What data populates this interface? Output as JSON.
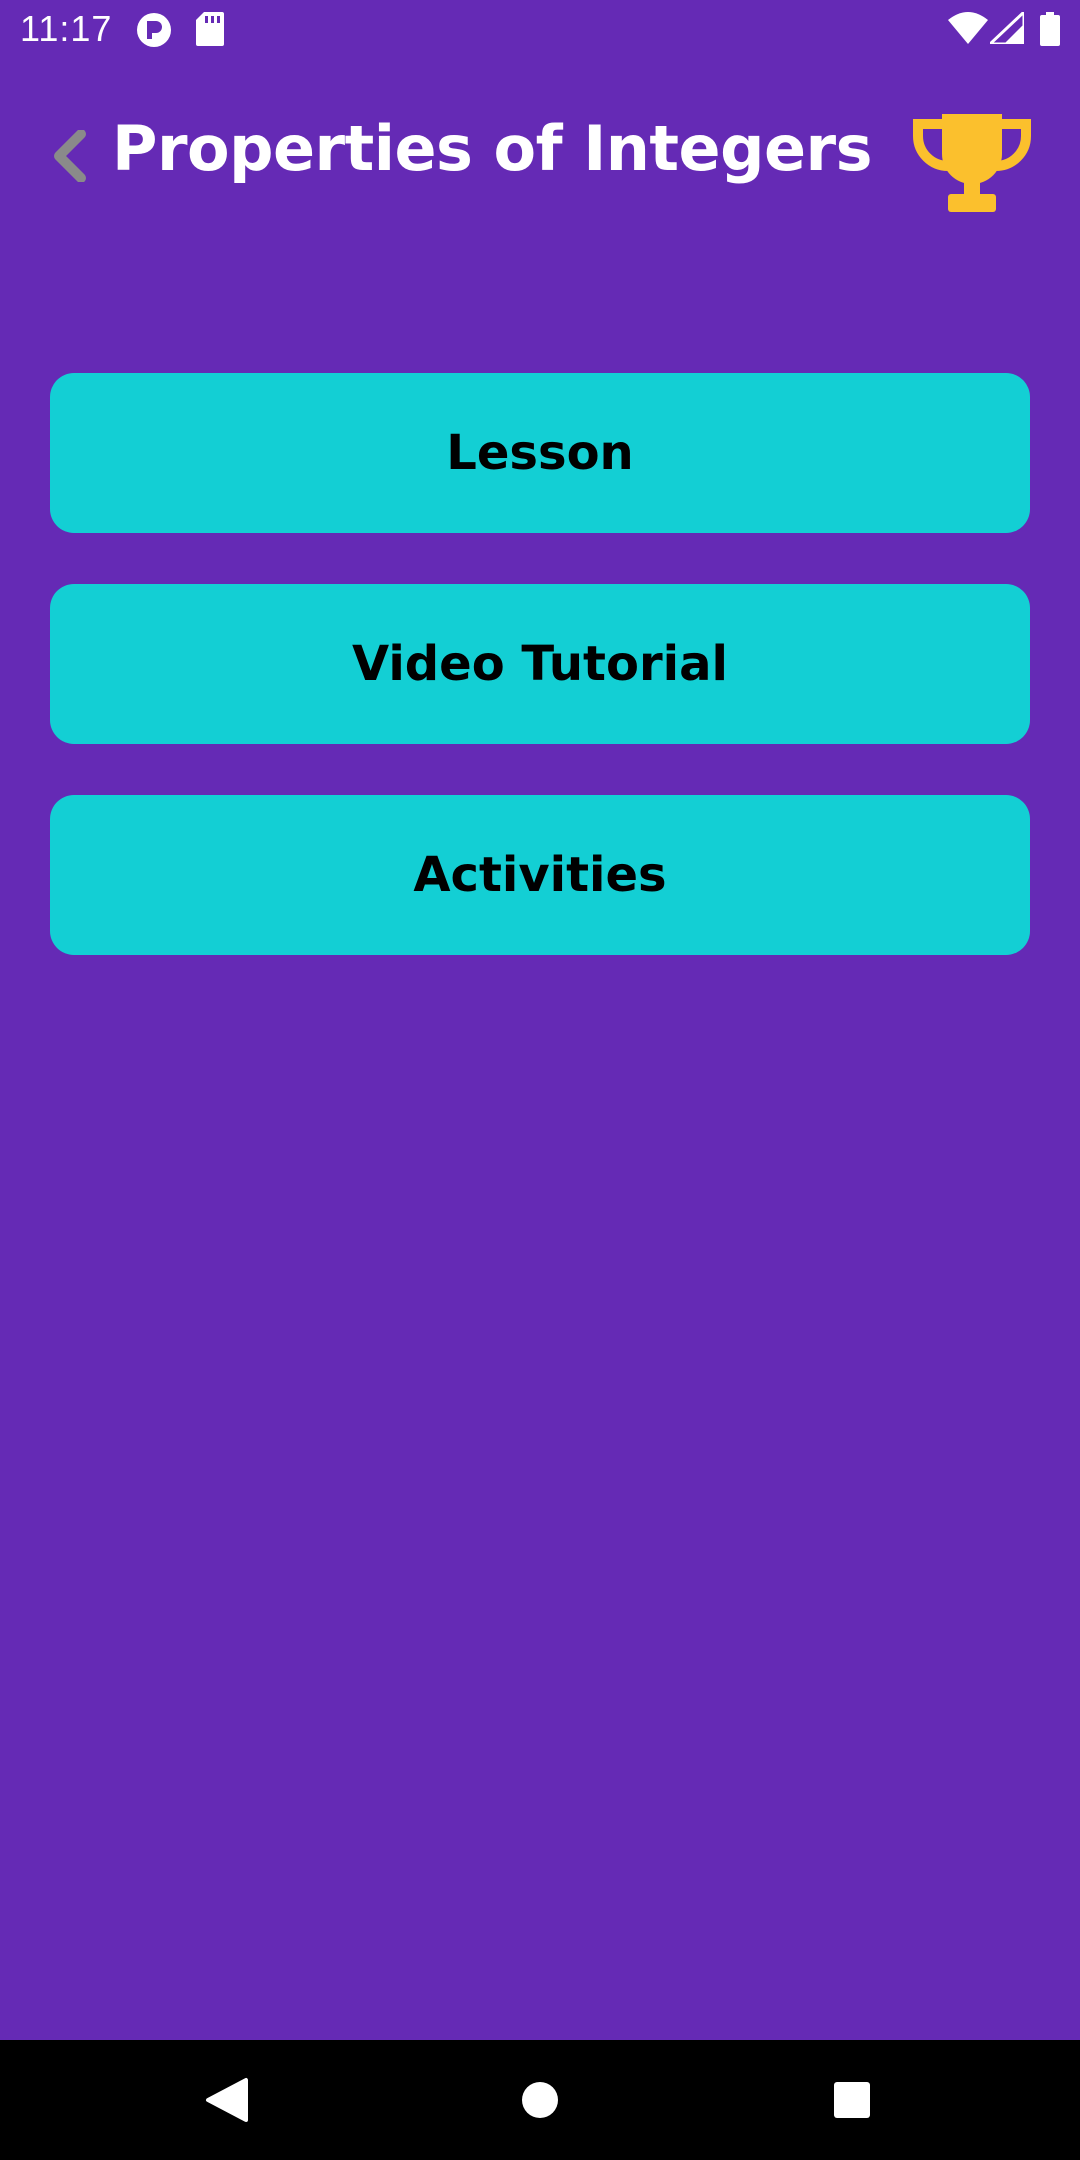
{
  "status_bar": {
    "time": "11:17",
    "icons": [
      "notification-app-icon",
      "sd-card-icon",
      "wifi-icon",
      "signal-icon",
      "battery-icon"
    ]
  },
  "header": {
    "back_icon": "chevron-left-icon",
    "title": "Properties of Integers",
    "trophy_icon": "trophy-icon"
  },
  "menu": {
    "items": [
      {
        "label": "Lesson"
      },
      {
        "label": "Video Tutorial"
      },
      {
        "label": "Activities"
      }
    ]
  },
  "nav_bar": {
    "icons": [
      "back-triangle-icon",
      "home-circle-icon",
      "recents-square-icon"
    ]
  },
  "colors": {
    "background": "#652AB5",
    "button": "#13CFD4",
    "trophy": "#FBC02D",
    "back_chevron": "#8A8A8A"
  }
}
